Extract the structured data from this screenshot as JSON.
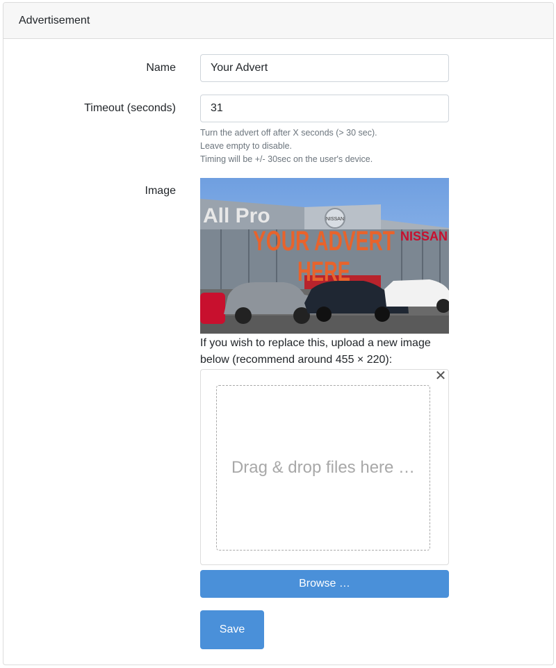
{
  "card": {
    "title": "Advertisement"
  },
  "form": {
    "name": {
      "label": "Name",
      "value": "Your Advert"
    },
    "timeout": {
      "label": "Timeout (seconds)",
      "value": "31",
      "help": [
        "Turn the advert off after X seconds (> 30 sec).",
        "Leave empty to disable.",
        "Timing will be +/- 30sec on the user's device."
      ]
    },
    "image": {
      "label": "Image",
      "preview": {
        "overlay_line1": "YOUR ADVERT",
        "overlay_line2": "HERE",
        "sign_left": "All Pro",
        "sign_right": "NISSAN",
        "badge": "NISSAN"
      },
      "replace_note": "If you wish to replace this, upload a new image below (recommend around 455 × 220):",
      "dropzone_text": "Drag & drop files here …",
      "close_glyph": "✕",
      "browse_label": "Browse …"
    }
  },
  "actions": {
    "save_label": "Save"
  },
  "colors": {
    "primary": "#4a90d9",
    "header_bg": "#f7f7f7",
    "overlay_text": "#e8632c"
  }
}
